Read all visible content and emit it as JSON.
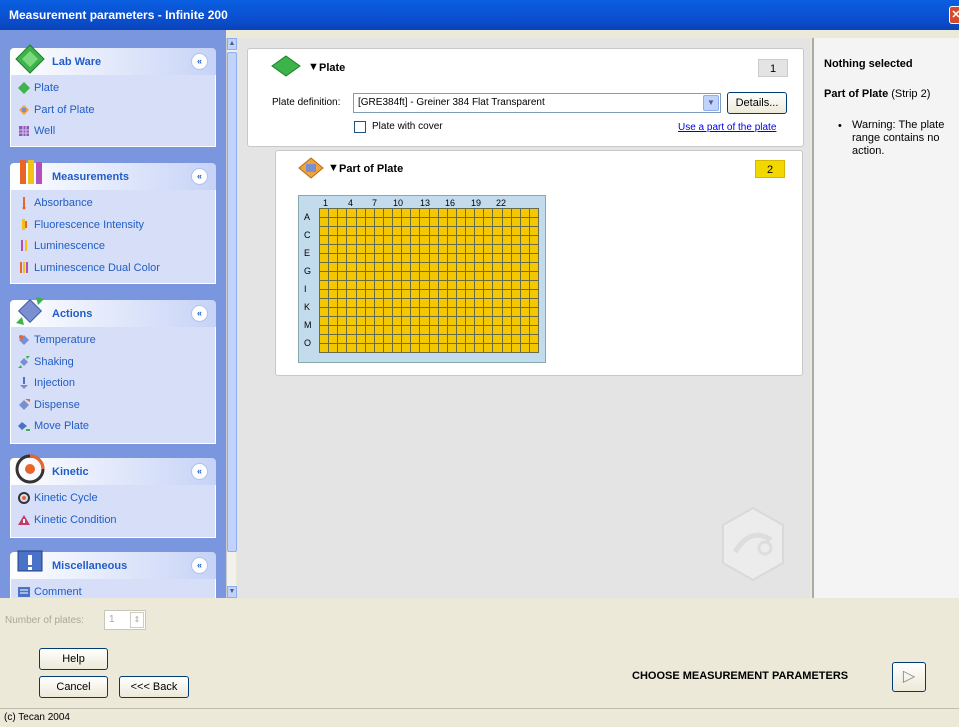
{
  "window": {
    "title": "Measurement parameters - Infinite 200",
    "close_glyph": "✕"
  },
  "sidebar": {
    "groups": [
      {
        "title": "Lab Ware",
        "items": [
          "Plate",
          "Part of Plate",
          "Well"
        ]
      },
      {
        "title": "Measurements",
        "items": [
          "Absorbance",
          "Fluorescence Intensity",
          "Luminescence",
          "Luminescence Dual Color"
        ]
      },
      {
        "title": "Actions",
        "items": [
          "Temperature",
          "Shaking",
          "Injection",
          "Dispense",
          "Move Plate"
        ]
      },
      {
        "title": "Kinetic",
        "items": [
          "Kinetic Cycle",
          "Kinetic Condition"
        ]
      },
      {
        "title": "Miscellaneous",
        "items": [
          "Comment"
        ]
      }
    ],
    "collapse_glyph": "«"
  },
  "plate_section": {
    "title": "Plate",
    "number": "1",
    "definition_label": "Plate definition:",
    "definition_value": "[GRE384ft] - Greiner 384 Flat Transparent",
    "details_button": "Details...",
    "cover_checkbox_label": "Plate with cover",
    "cover_checked": false,
    "part_link": "Use a part of the plate"
  },
  "part_section": {
    "title": "Part of Plate",
    "number": "2",
    "column_labels": [
      "1",
      "4",
      "7",
      "10",
      "13",
      "16",
      "19",
      "22"
    ],
    "row_labels": [
      "A",
      "C",
      "E",
      "G",
      "I",
      "K",
      "M",
      "O"
    ]
  },
  "info_panel": {
    "heading": "Nothing selected",
    "subject_bold": "Part of Plate",
    "subject_rest": " (Strip 2)",
    "warning": "Warning: The plate range contains no action."
  },
  "bottom": {
    "plates_label": "Number of plates:",
    "plates_value": "1",
    "help_button": "Help",
    "cancel_button": "Cancel",
    "back_button": "<<< Back",
    "step_caption": "CHOOSE MEASUREMENT PARAMETERS",
    "next_glyph": "▷"
  },
  "status": {
    "copyright": "(c) Tecan 2004"
  },
  "colors": {
    "accent": "#215dc6",
    "badge_1": "#e4e4e4",
    "badge_2": "#f3d800",
    "well": "#f3c800",
    "sidebar_bg": "#7a96df"
  }
}
